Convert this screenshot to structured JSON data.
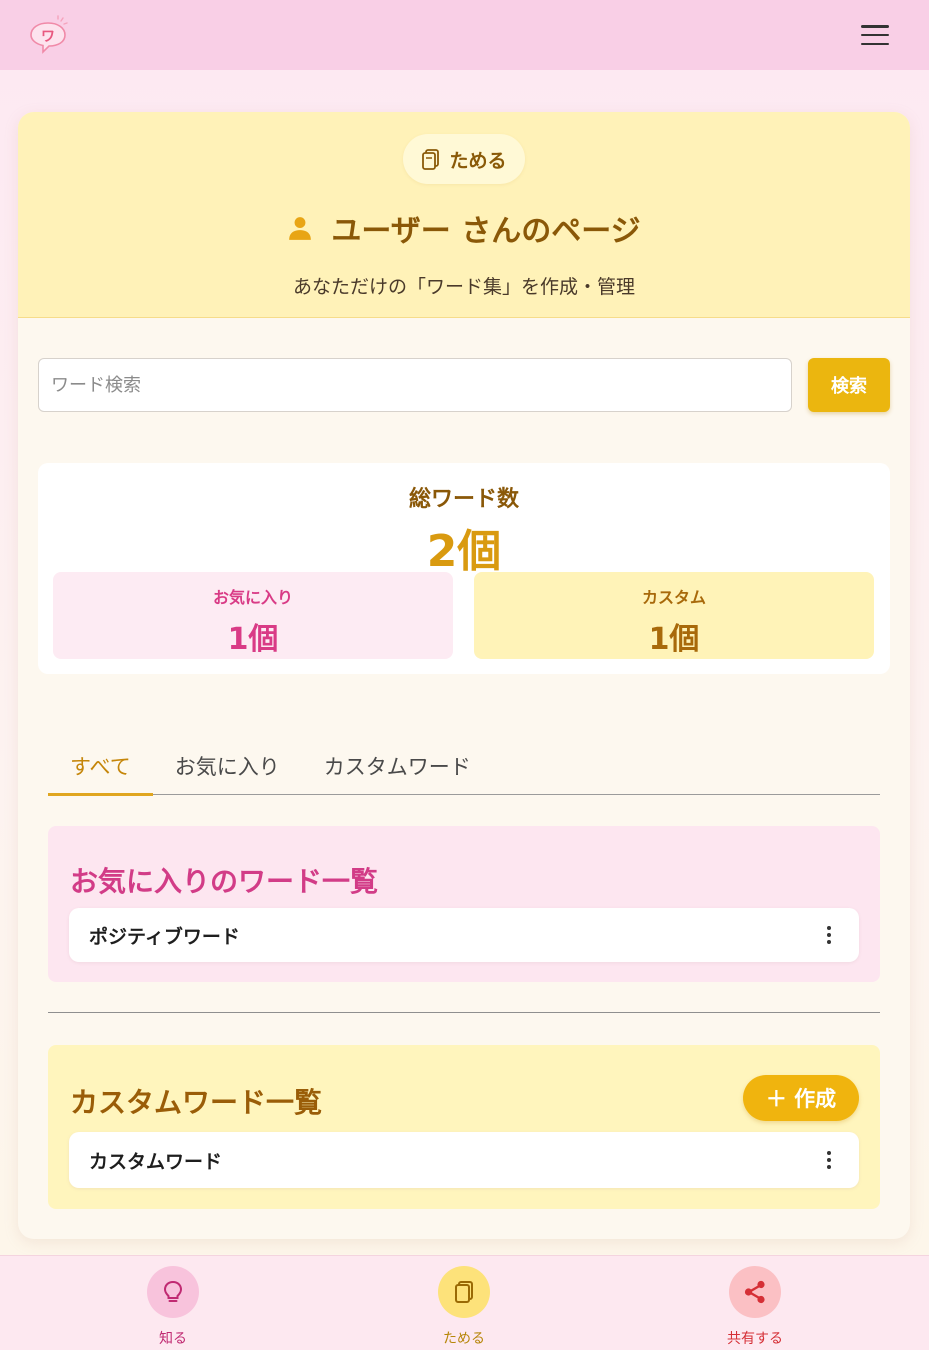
{
  "header": {
    "logo_char": "ワ",
    "menu_icon": "hamburger-icon"
  },
  "page": {
    "section_pill": "ためる",
    "title": "ユーザー さんのページ",
    "subtitle": "あなただけの「ワード集」を作成・管理"
  },
  "search": {
    "placeholder": "ワード検索",
    "value": "",
    "button": "検索"
  },
  "stats": {
    "total_label": "総ワード数",
    "total_value": "2個",
    "favorites_label": "お気に入り",
    "favorites_value": "1個",
    "custom_label": "カスタム",
    "custom_value": "1個"
  },
  "tabs": [
    {
      "label": "すべて",
      "active": true
    },
    {
      "label": "お気に入り",
      "active": false
    },
    {
      "label": "カスタムワード",
      "active": false
    }
  ],
  "favorites_section": {
    "title": "お気に入りのワード一覧",
    "items": [
      {
        "text": "ポジティブワード"
      }
    ]
  },
  "custom_section": {
    "title": "カスタムワード一覧",
    "create_button": "＋ 作成",
    "items": [
      {
        "text": "カスタムワード"
      }
    ]
  },
  "bottom_nav": [
    {
      "label": "知る",
      "icon": "lightbulb-icon"
    },
    {
      "label": "ためる",
      "icon": "notebook-icon"
    },
    {
      "label": "共有する",
      "icon": "share-icon"
    }
  ],
  "colors": {
    "header_bg": "#f9cfe6",
    "accent_yellow": "#ebb60f",
    "favorite_pink": "#d93b86",
    "custom_brown": "#9a5d08"
  }
}
